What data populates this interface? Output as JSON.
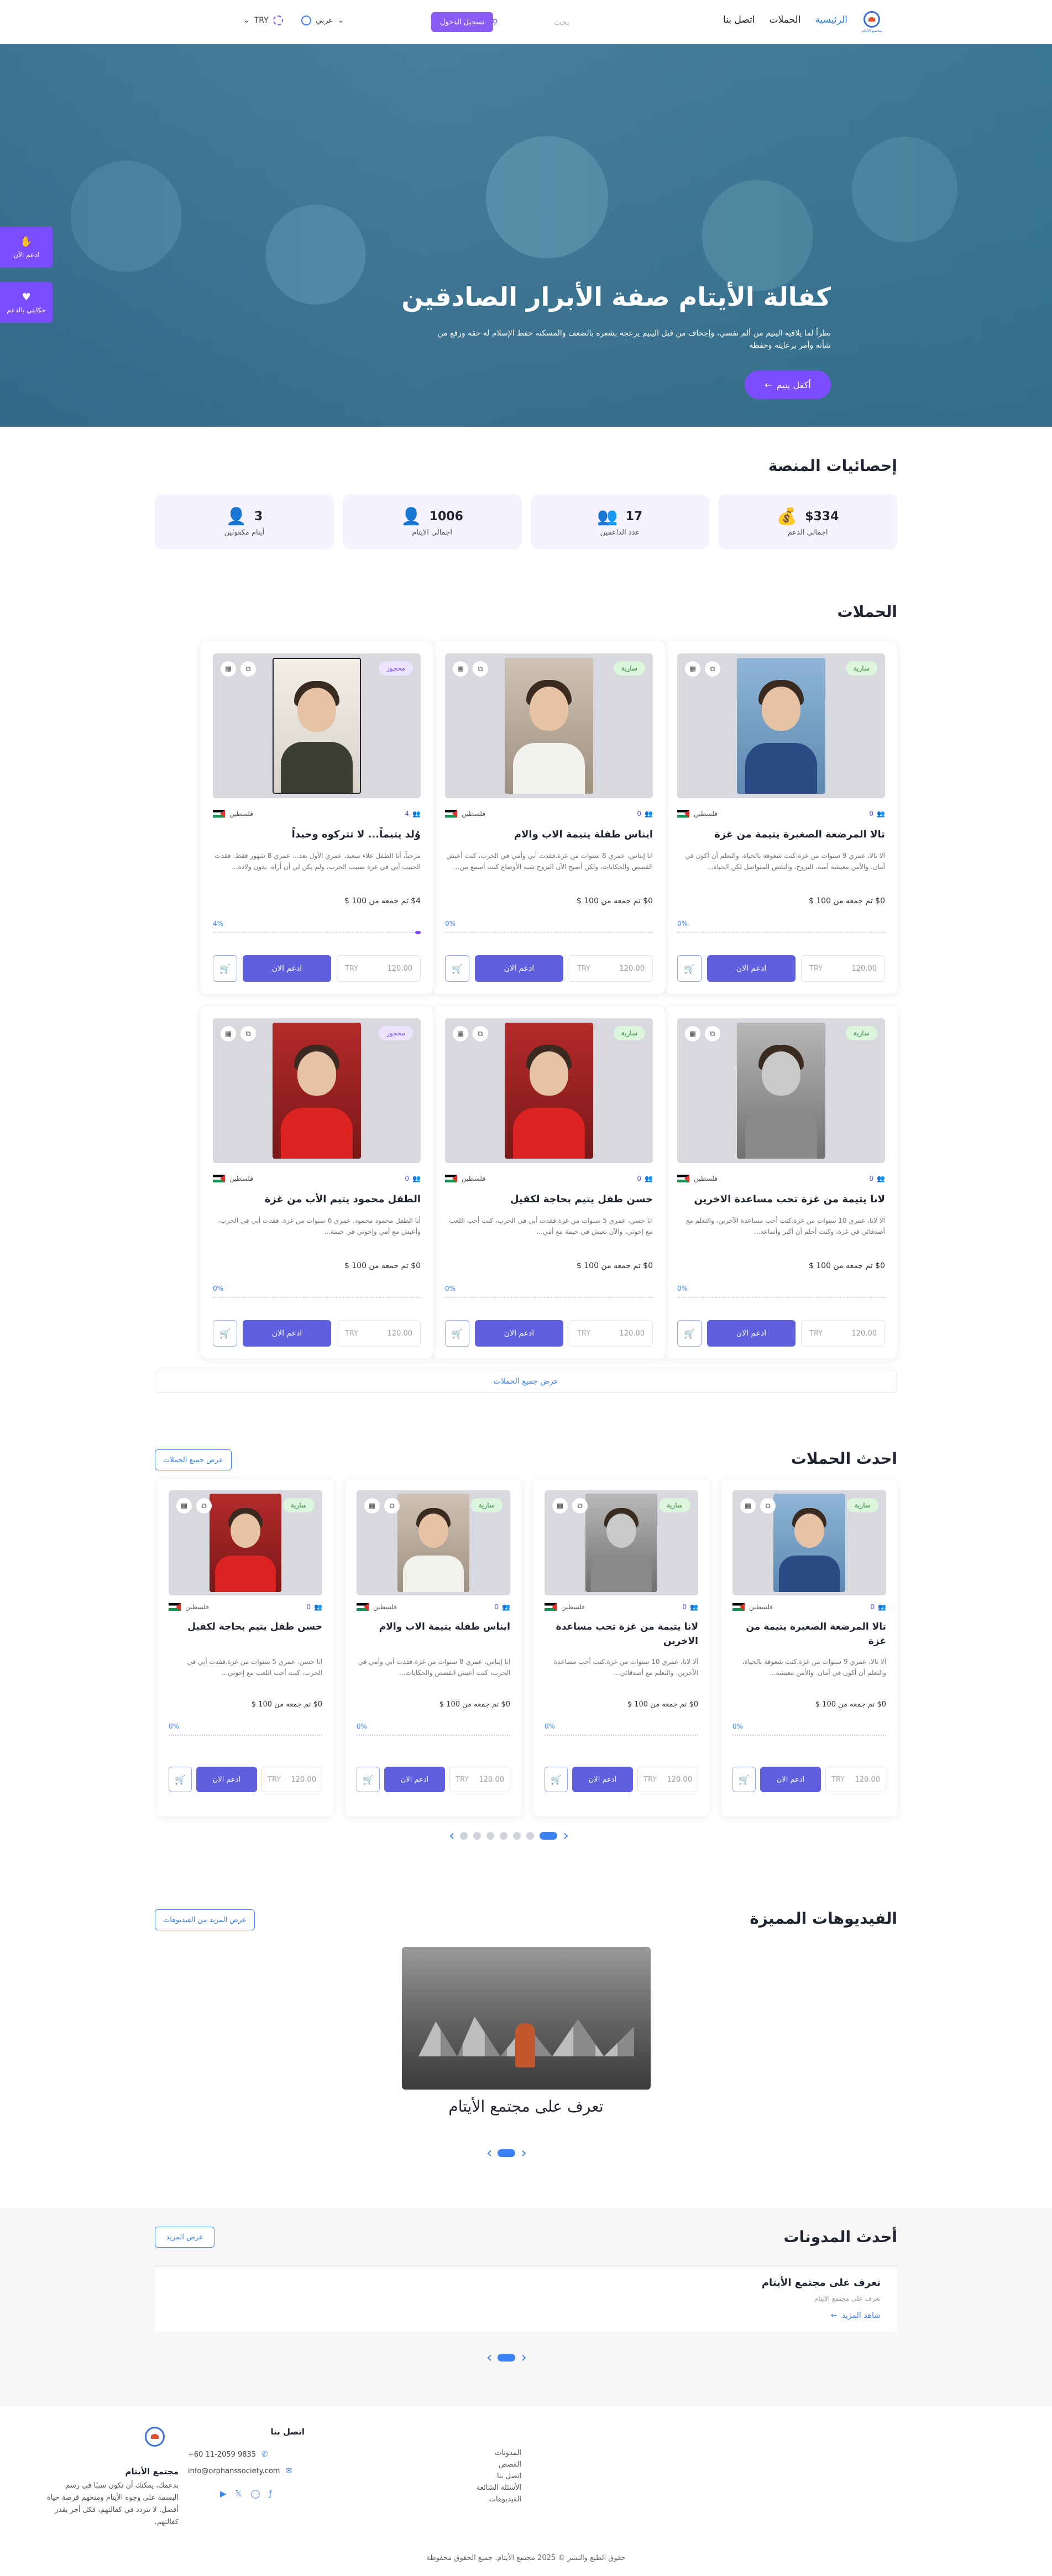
{
  "nav": {
    "logo_text": "مجتمع الأيتام",
    "links": [
      "الرئيسية",
      "الحملات",
      "اتصل بنا"
    ],
    "search_placeholder": "بحث",
    "login": "تسجيل الدخول",
    "language": "عربي",
    "currency": "TRY"
  },
  "hero": {
    "title": "كفالة الأيتام صفة الأبرار الصادقين",
    "subtitle": "نظراً لما يلاقيه اليتيم من ألم نفسي، وإجحاف من قبل اليتيم يزعجه بشعره بالضعف والمسكنة حفظ الإسلام له حقه ورفع من شأنه وأمر برعايته وحفظه",
    "cta": "أكفل يتيم"
  },
  "side_tabs": [
    "ادعم الآن",
    "حكايتي بالدعم"
  ],
  "stats_section": {
    "title": "إحصائيات المنصة",
    "items": [
      {
        "value": "$334",
        "label": "اجمالي الدعم",
        "icon": "hand-coin-icon"
      },
      {
        "value": "17",
        "label": "عدد الداعمين",
        "icon": "users-plus-icon"
      },
      {
        "value": "1006",
        "label": "اجمالي الايتام",
        "icon": "person-icon"
      },
      {
        "value": "3",
        "label": "أيتام مكفولين",
        "icon": "person-icon"
      }
    ]
  },
  "campaigns_section": {
    "title": "الحملات",
    "view_all": "عرض جميع الحملات",
    "support_label": "ادعم الان",
    "country": "فلسطين",
    "currency": "TRY",
    "amount_placeholder": "120.00",
    "cards": [
      {
        "status": "سارية",
        "title": "تالا المرضعة الصغيرة يتيمة من غزة",
        "desc": "آلا تالا، عمري 9 سنوات من غزة.كنت شغوفة بالحياة، والتعلم أن أكون في أمان. والأمن معيشة آمنة، النزوح، والنقص المتواصل لكن الحياة...",
        "raised": "$0 تم جمعه من 100 $",
        "percent": 0,
        "donors": "0",
        "photo": "blue"
      },
      {
        "status": "سارية",
        "title": "ايناس طفلة يتيمة الاب والام",
        "desc": "انا إيناس، عمري 8 سنوات من غزة.فقدت أبي وأمي في الحرب، كنت أعيش القصص والحكايات، ولكن أصبح الآن النزوح شبه الأوضاع كنت أسمع من...",
        "raised": "$0 تم جمعه من 100 $",
        "percent": 0,
        "donors": "0",
        "photo": "white"
      },
      {
        "status": "محجوز",
        "title": "وُلد يتيماً... لا تتركوه وحيداً",
        "desc": "مرحباً، أنا الطفل علاء سعيد، عمري الأول بعد... عمري 8 شهور فقط. فقدت الحبيب أبي في غزة بسبب الحرب، ولم يكن لي أن أراه. بدون ولادة...",
        "raised": "$4 تم جمعه من 100 $",
        "percent": 4,
        "donors": "4",
        "photo": "baby"
      },
      {
        "status": "سارية",
        "title": "لانا يتيمة من غزة تحب مساعدة الاخرين",
        "desc": "آلا لانا، عمري 10 سنوات من غزة.كنت أحب مساعدة الآخرين، والتعلم مع أصدقائي في غزة، وكنت أحلم أن أكبر وأساعد...",
        "raised": "$0 تم جمعه من 100 $",
        "percent": 0,
        "donors": "0",
        "photo": "gray"
      },
      {
        "status": "سارية",
        "title": "حسن طفل يتيم بحاجة لكفيل",
        "desc": "انا حسن، عمري 5 سنوات من غزة.فقدت أبي في الحرب، كنت أحب اللعب مع إخوتي، والآن نعيش في خيمة مع أمي...",
        "raised": "$0 تم جمعه من 100 $",
        "percent": 0,
        "donors": "0",
        "photo": "red"
      },
      {
        "status": "محجوز",
        "title": "الطفل محمود يتيم الأب من غزة",
        "desc": "أنا الطفل محمود محمود، عمري 6 سنوات من غزة. فقدت أبي في الحرب، وأعيش مع أمي وإخوتي في خيمة...",
        "raised": "$0 تم جمعه من 100 $",
        "percent": 0,
        "donors": "0",
        "photo": "red2"
      }
    ]
  },
  "latest_section": {
    "title": "احدث الحملات",
    "view_all": "عرض جميع الحملات",
    "cards": [
      {
        "status": "سارية",
        "title": "تالا المرضعة الصغيرة يتيمة من غزة",
        "desc": "آلا تالا، عمري 9 سنوات من غزة.كنت شغوفة بالحياة، والتعلم أن أكون في أمان. والأمن معيشة...",
        "raised": "$0 تم جمعه من 100 $",
        "donors": "0",
        "photo": "blue"
      },
      {
        "status": "سارية",
        "title": "لانا يتيمة من غزة تحب مساعدة الاخرين",
        "desc": "آلا لانا، عمري 10 سنوات من غزة.كنت أحب مساعدة الآخرين، والتعلم مع أصدقائي...",
        "raised": "$0 تم جمعه من 100 $",
        "donors": "0",
        "photo": "gray"
      },
      {
        "status": "سارية",
        "title": "ايناس طفلة يتيمة الاب والام",
        "desc": "انا إيناس، عمري 8 سنوات من غزة.فقدت أبي وأمي في الحرب، كنت أعيش القصص والحكايات...",
        "raised": "$0 تم جمعه من 100 $",
        "donors": "0",
        "photo": "white"
      },
      {
        "status": "سارية",
        "title": "حسن طفل يتيم بحاجة لكفيل",
        "desc": "انا حسن، عمري 5 سنوات من غزة.فقدت أبي في الحرب، كنت أحب اللعب مع إخوتي...",
        "raised": "$0 تم جمعه من 100 $",
        "donors": "0",
        "photo": "red"
      }
    ]
  },
  "videos_section": {
    "title": "الفيديوهات المميزة",
    "more": "عرض المزيد من الفيديوهات",
    "caption": "تعرف على مجتمع الأيتام"
  },
  "blog_section": {
    "title": "أحدث المدونات",
    "more": "عرض المزيد",
    "post_title": "تعرف على مجتمع الأيتام",
    "post_sub": "تعرف على مجتمع الايتام",
    "read_more": "شاهد المزيد"
  },
  "footer": {
    "name": "مجتمع الأيتام",
    "desc": "بدعمك، يمكنك أن تكون سببًا في رسم البسمة على وجوه الأيتام ومنحهم فرصة حياة أفضل. لا تتردد في كفالتهم، فكل أجر بقدر كفالتهم.",
    "links": [
      "المدونات",
      "القصص",
      "اتصل بنا",
      "الأسئلة الشائعة",
      "الفيديوهات"
    ],
    "contact_title": "اتصل بنا",
    "phone": "+60 11-2059 9835",
    "email": "info@orphanssociety.com",
    "copyright": "حقوق الطبع والنشر © 2025 مجتمع الأيتام. جميع الحقوق محفوظة"
  }
}
